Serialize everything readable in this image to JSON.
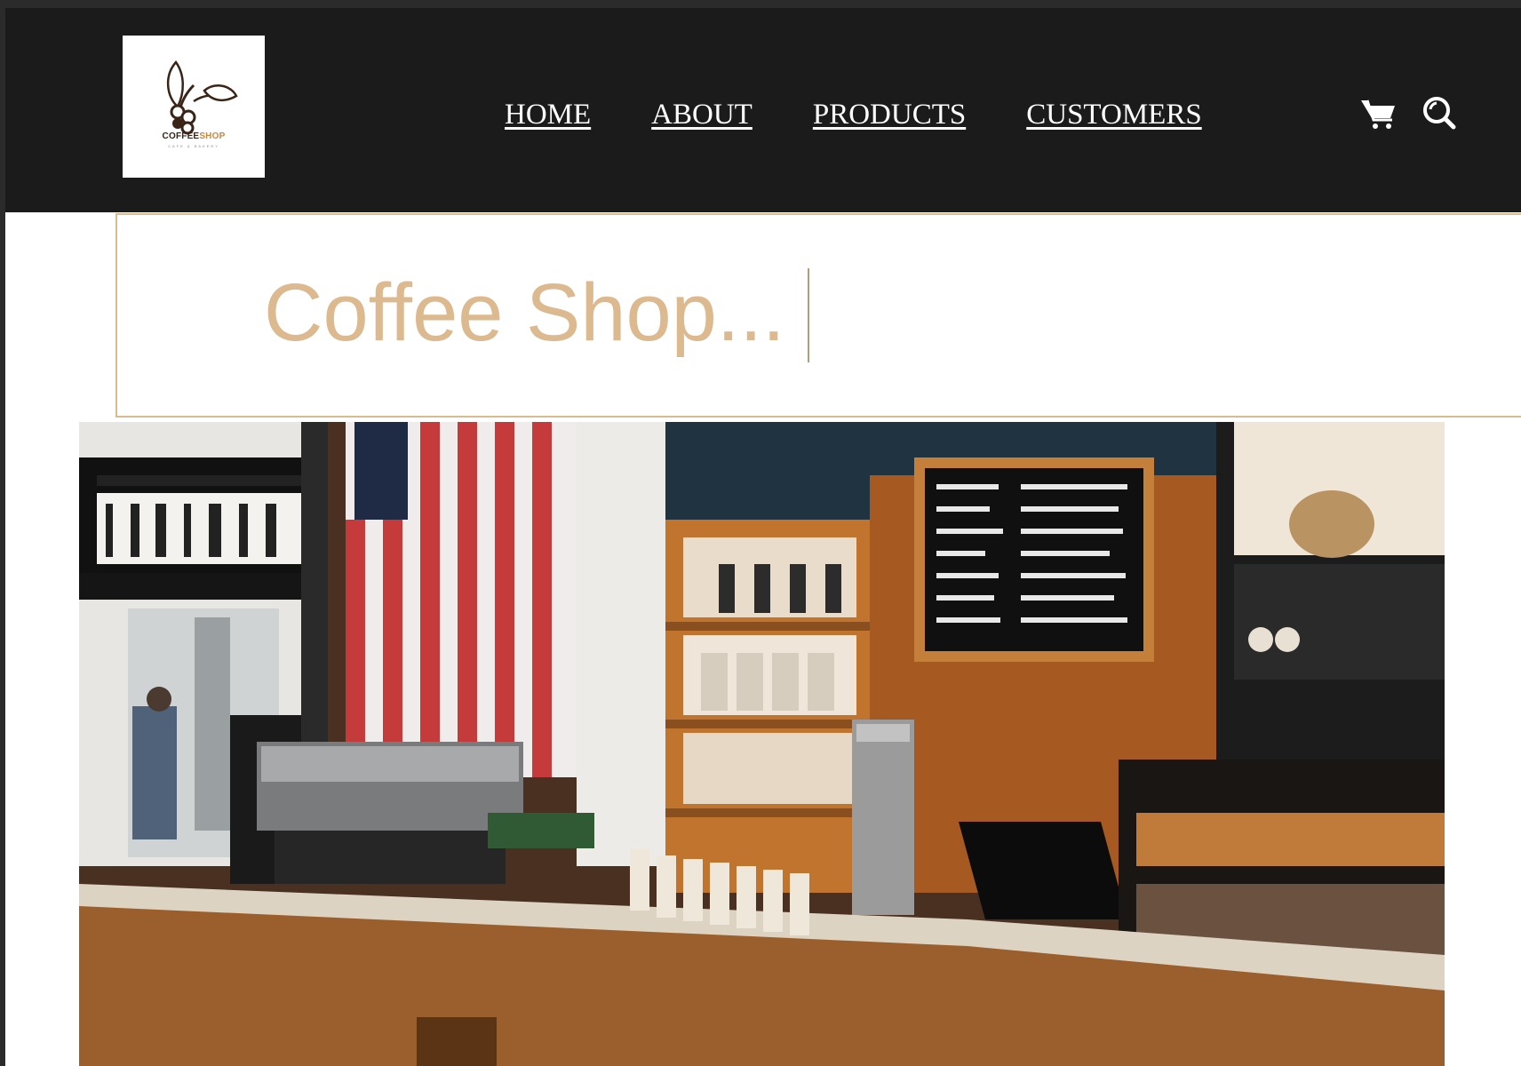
{
  "header": {
    "logo": {
      "brand_dark": "COFFEE",
      "brand_accent": "SHOP",
      "tagline": "CAFE & BAKERY"
    },
    "nav": [
      "HOME",
      "ABOUT",
      "PRODUCTS",
      "CUSTOMERS"
    ],
    "icons": {
      "cart": "cart-icon",
      "search": "search-icon"
    }
  },
  "hero": {
    "title": "Coffee Shop..."
  },
  "photo": {
    "subject": "coffee shop counter interior"
  },
  "colors": {
    "header_bg": "#1b1b1b",
    "title_color": "#dcb98e",
    "title_border": "#d9bb8e",
    "brand_accent": "#c8873f"
  }
}
